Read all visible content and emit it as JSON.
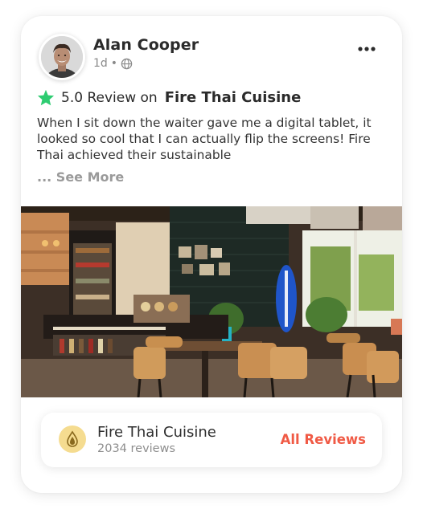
{
  "post": {
    "author": {
      "name": "Alan Cooper",
      "time": "1d",
      "separator": "•",
      "visibility_icon": "globe-icon"
    },
    "menu_icon": "more-horizontal-icon",
    "rating": {
      "star_icon": "star-icon",
      "star_color": "#2ecc71",
      "text": "5.0 Review on",
      "restaurant": "Fire Thai Cuisine"
    },
    "body": "When I sit down the waiter gave me a digital tablet, it looked so cool that I can actually flip the screens! Fire Thai achieved their sustainable",
    "see_more": "... See More",
    "photo_description": "restaurant-interior-photo"
  },
  "business": {
    "logo_icon": "flame-drop-icon",
    "logo_bg": "#f5dc90",
    "name": "Fire Thai Cuisine",
    "reviews": "2034 reviews",
    "link_label": "All Reviews",
    "link_color": "#f05a45"
  }
}
